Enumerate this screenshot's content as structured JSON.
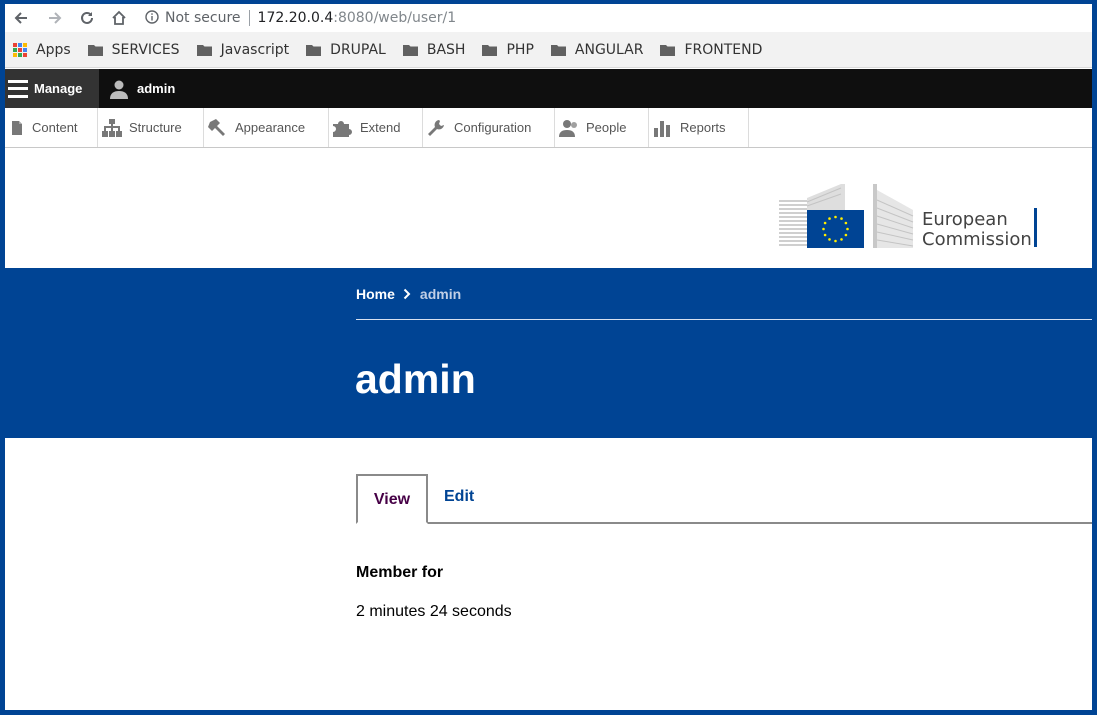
{
  "browser": {
    "not_secure": "Not secure",
    "url_host": "172.20.0.4",
    "url_rest": ":8080/web/user/1"
  },
  "bookmarks": [
    {
      "label": "Apps",
      "icon": "apps-grid-icon"
    },
    {
      "label": "SERVICES",
      "icon": "folder-icon"
    },
    {
      "label": "Javascript",
      "icon": "folder-icon"
    },
    {
      "label": "DRUPAL",
      "icon": "folder-icon"
    },
    {
      "label": "BASH",
      "icon": "folder-icon"
    },
    {
      "label": "PHP",
      "icon": "folder-icon"
    },
    {
      "label": "ANGULAR",
      "icon": "folder-icon"
    },
    {
      "label": "FRONTEND",
      "icon": "folder-icon"
    }
  ],
  "toolbar": {
    "manage": "Manage",
    "user": "admin"
  },
  "tray": [
    {
      "label": "Content",
      "icon": "content-icon"
    },
    {
      "label": "Structure",
      "icon": "structure-icon"
    },
    {
      "label": "Appearance",
      "icon": "appearance-icon"
    },
    {
      "label": "Extend",
      "icon": "extend-icon"
    },
    {
      "label": "Configuration",
      "icon": "configuration-icon"
    },
    {
      "label": "People",
      "icon": "people-icon"
    },
    {
      "label": "Reports",
      "icon": "reports-icon"
    }
  ],
  "logo": {
    "line1": "European",
    "line2": "Commission"
  },
  "breadcrumb": {
    "home": "Home",
    "current": "admin"
  },
  "page": {
    "title": "admin",
    "tabs": [
      {
        "label": "View"
      },
      {
        "label": "Edit"
      }
    ],
    "field_label": "Member for",
    "field_value": "2 minutes 24 seconds"
  },
  "colors": {
    "brand_blue": "#004494",
    "toolbar_black": "#0f0f0f",
    "active_tab_text": "#460046"
  }
}
